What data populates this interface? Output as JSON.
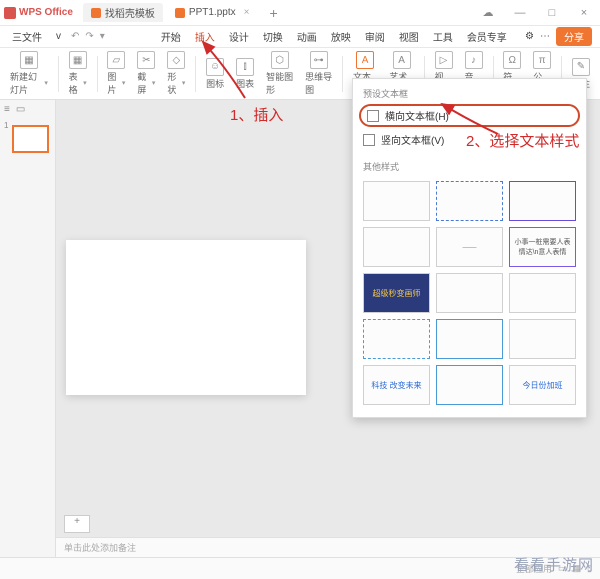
{
  "title": {
    "app": "WPS Office",
    "tab1": "找稻壳模板",
    "tab2": "PPT1.pptx"
  },
  "menu": {
    "items": [
      "三文件",
      "v",
      "开始",
      "插入",
      "设计",
      "切换",
      "动画",
      "放映",
      "审阅",
      "视图",
      "工具",
      "会员专享"
    ],
    "share": "分享"
  },
  "toolbar": {
    "newSlide": "新建幻灯片",
    "table": "表格",
    "pic": "图片",
    "screenshot": "截屏",
    "shape": "形状",
    "icons": "图标",
    "chart": "图表",
    "smartart": "智能图形",
    "mindmap": "思维导图",
    "textbox": "文本框",
    "wordart": "艺术字",
    "video": "视频",
    "audio": "音频",
    "symbol": "符号",
    "formula": "公式",
    "comment": "批注"
  },
  "dropdown": {
    "presetTitle": "预设文本框",
    "horiz": "横向文本框(H)",
    "vert": "竖向文本框(V)",
    "otherTitle": "其他样式",
    "cards": [
      "",
      "",
      "",
      "",
      "——",
      "小事一桩需要人表情达\\n意人表情",
      "超级秒变画师",
      "",
      "",
      "",
      "",
      "",
      "科技 改变未来",
      "",
      "今日份加班"
    ]
  },
  "annotation": {
    "a1": "1、插入",
    "a2": "2、选择文本样式"
  },
  "notes": "单击此处添加备注",
  "status": {
    "apply": "全部应用"
  },
  "watermark": "看看手游网"
}
